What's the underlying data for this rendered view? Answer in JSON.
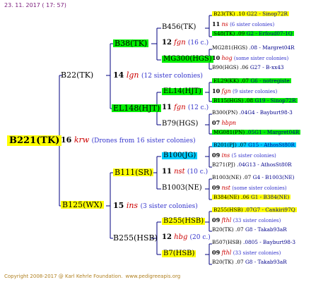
{
  "header": {
    "date": "23. 11. 2017 ( 17: 57)"
  },
  "footer": {
    "copyright": "Copyright 2008-2017 @ Karl Kehrle Foundation.",
    "url": "www.pedigreeapis.org"
  },
  "colors": {
    "highlight_yellow": "#ffff00",
    "highlight_green": "#00ee00",
    "highlight_cyan": "#00ccff",
    "red": "#cc0000",
    "link": "#3333cc",
    "lines": "#000080"
  },
  "root": {
    "label": "B221(TK)"
  },
  "gen1": {
    "year": "16",
    "code": "krw",
    "siblings": "(Drones from 16 sister colonies)",
    "sire": "B22(TK)",
    "dam": "B125(WX)"
  },
  "gen2": [
    {
      "year": "14",
      "code": "lgn",
      "siblings": "(12 sister colonies)",
      "sire": "B38(TK)",
      "dam": "EL148(HJT)"
    },
    {
      "year": "15",
      "code": "ins",
      "siblings": "(3 sister colonies)",
      "sire": "B111(SR)",
      "dam": "B255(HSB)"
    }
  ],
  "gen3": [
    {
      "year": "12",
      "code": "fgn",
      "siblings": "(16 c.)",
      "sire": "B456(TK)",
      "dam": "MG300(HGS)"
    },
    {
      "year": "11",
      "code": "fgn",
      "siblings": "(12 c.)",
      "sire": "EL14(HJT)",
      "dam": "B79(HGS)"
    },
    {
      "year": "11",
      "code": "nst",
      "siblings": "(10 c.)",
      "sire": "B100(JG)",
      "dam": "B1003(NE)"
    },
    {
      "year": "12",
      "code": "hbg",
      "siblings": "(20 c.)",
      "sire": "B255(HSB)",
      "dam": "B7(HSB)"
    }
  ],
  "gen4": [
    {
      "sire": {
        "name": "B23(TK)",
        "year": ".10",
        "ref": "G22 - Sinop72R"
      },
      "year": "11",
      "code": "ns",
      "siblings": "(6 sister colonies)",
      "dam": {
        "name": "S48(TK)",
        "year": ".09",
        "ref": "G2 - Erfoud07-1Q"
      }
    },
    {
      "sire": {
        "name": "MG281(HGS)",
        "year": "",
        "ref": ".08 - Margret04R"
      },
      "year": "10",
      "code": "hog",
      "siblings": "(some sister colonies)",
      "dam": {
        "name": "B90(HGS)",
        "year": ".06",
        "ref": "G27 - B-xx43"
      }
    },
    {
      "sire": {
        "name": "EL29(KK)",
        "year": ".07",
        "ref": "G6 - notregiste"
      },
      "year": "10",
      "code": "fgn",
      "siblings": "(9 sister colonies)",
      "dam": {
        "name": "B115(HGS)",
        "year": ".08",
        "ref": "G19 - Sinop72R"
      }
    },
    {
      "sire": {
        "name": "B300(PN)",
        "year": "",
        "ref": ".04G4 - Bayburt98-3"
      },
      "year": "07",
      "code": "hbpn",
      "siblings": "",
      "dam": {
        "name": "MG081(PN)",
        "year": "",
        "ref": ".05G1 - Margret04R"
      }
    },
    {
      "sire": {
        "name": "B201(PJ)",
        "year": ".07",
        "ref": "G15 - AthosSt80R"
      },
      "year": "09",
      "code": "ins",
      "siblings": "(5 sister colonies)",
      "dam": {
        "name": "B271(PJ)",
        "year": "",
        "ref": ".04G13 - AthosSt80R"
      }
    },
    {
      "sire": {
        "name": "B1003(NE)",
        "year": ".07",
        "ref": "G4 - B1003(NE)"
      },
      "year": "09",
      "code": "nst",
      "siblings": "(some sister colonies)",
      "dam": {
        "name": "B384(NE)",
        "year": ".06",
        "ref": "G1 - B384(NE)"
      }
    },
    {
      "sire": {
        "name": "B255(HSB)",
        "year": "",
        "ref": ".07G7 - Cankiri97Q"
      },
      "year": "09",
      "code": "fthl",
      "siblings": "(33 sister colonies)",
      "dam": {
        "name": "B20(TK)",
        "year": ".07",
        "ref": "G8 - Takab93aR"
      }
    },
    {
      "sire": {
        "name": "B507(HSB)",
        "year": "",
        "ref": ".0805 - Bayburt98-3"
      },
      "year": "09",
      "code": "fthl",
      "siblings": "(33 sister colonies)",
      "dam": {
        "name": "B20(TK)",
        "year": ".07",
        "ref": "G8 - Takab93aR"
      }
    }
  ]
}
